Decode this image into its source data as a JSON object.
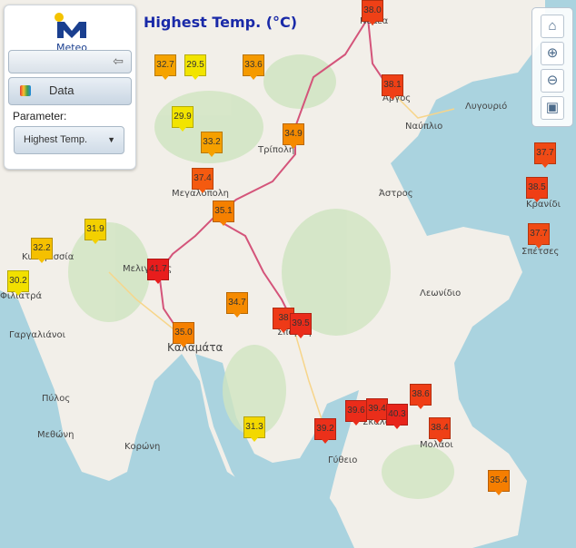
{
  "panel": {
    "logo_text": "Meteo",
    "data_label": "Data",
    "parameter_label": "Parameter:",
    "parameter_value": "Highest Temp."
  },
  "map_title": "Highest Temp. (°C)",
  "markers": [
    {
      "value": "32.7",
      "color": "#f5a300"
    },
    {
      "value": "29.5",
      "color": "#f2e400"
    },
    {
      "value": "33.6",
      "color": "#f59a00"
    },
    {
      "value": "29.9",
      "color": "#f2e400"
    },
    {
      "value": "33.2",
      "color": "#f5a000"
    },
    {
      "value": "34.9",
      "color": "#f58a00"
    },
    {
      "value": "37.4",
      "color": "#f45a10"
    },
    {
      "value": "35.1",
      "color": "#f58000"
    },
    {
      "value": "31.9",
      "color": "#f3d000"
    },
    {
      "value": "32.2",
      "color": "#f5c000"
    },
    {
      "value": "30.2",
      "color": "#f2e000"
    },
    {
      "value": "41.7",
      "color": "#e81d1d"
    },
    {
      "value": "34.7",
      "color": "#f58a00"
    },
    {
      "value": "35.0",
      "color": "#f58000"
    },
    {
      "value": "38",
      "color": "#ee3a17"
    },
    {
      "value": "39.5",
      "color": "#ea2c1a"
    },
    {
      "value": "38.1",
      "color": "#ef4016"
    },
    {
      "value": "37.7",
      "color": "#f04a15"
    },
    {
      "value": "38.5",
      "color": "#ef3e16"
    },
    {
      "value": "37.7",
      "color": "#f04a15"
    },
    {
      "value": "39.6",
      "color": "#ea2c1a"
    },
    {
      "value": "39.4",
      "color": "#ea2e1a"
    },
    {
      "value": "40.3",
      "color": "#e8241b"
    },
    {
      "value": "38.6",
      "color": "#ef3e16"
    },
    {
      "value": "38.4",
      "color": "#ef4016"
    },
    {
      "value": "39.2",
      "color": "#eb301a"
    },
    {
      "value": "31.3",
      "color": "#f3d800"
    },
    {
      "value": "35.4",
      "color": "#f57e00"
    },
    {
      "value": "38.0",
      "color": "#ef4016"
    }
  ],
  "places": [
    "Νεμέα",
    "Άργος",
    "Ναύπλιο",
    "Λυγουριό",
    "Τρίπολη",
    "Άστρος",
    "Κρανίδι",
    "Σπέτσες",
    "Μεγαλόπολη",
    "Κυπαρισσία",
    "Φιλιατρά",
    "Μελιγαλάς",
    "Λεωνίδιο",
    "Γαργαλιάνοι",
    "Καλαμάτα",
    "Σπάρτη",
    "Πύλος",
    "Μεθώνη",
    "Κορώνη",
    "Σκάλα",
    "Μολάοι",
    "Γύθειο"
  ]
}
